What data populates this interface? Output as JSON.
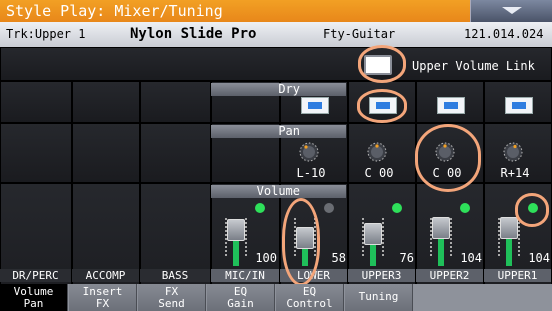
{
  "titlebar": {
    "title": "Style Play: Mixer/Tuning"
  },
  "trkbar": {
    "track": "Trk:Upper 1",
    "sound": "Nylon Slide Pro",
    "bank": "Fty-Guitar",
    "program": "121.014.024"
  },
  "upper_volume_link": {
    "label": "Upper Volume Link",
    "checked": false
  },
  "sections": {
    "dry": "Dry",
    "pan": "Pan",
    "volume": "Volume"
  },
  "channels": [
    {
      "name": "DR/PERC"
    },
    {
      "name": "ACCOMP"
    },
    {
      "name": "BASS"
    },
    {
      "name": "MIC/IN",
      "pan": "L-10",
      "volume": "100",
      "led": "on",
      "fader_level": 0.66
    },
    {
      "name": "LOWER",
      "volume": "58",
      "led": "off",
      "fader_level": 0.45
    },
    {
      "name": "UPPER3",
      "pan": "C 00",
      "volume": "76",
      "led": "on",
      "fader_level": 0.55
    },
    {
      "name": "UPPER2",
      "pan": "C 00",
      "volume": "104",
      "led": "on",
      "fader_level": 0.7
    },
    {
      "name": "UPPER1",
      "pan": "R+14",
      "volume": "104",
      "led": "on",
      "fader_level": 0.7
    }
  ],
  "tabs": [
    {
      "label": "Volume Pan",
      "active": true
    },
    {
      "label": "Insert FX"
    },
    {
      "label": "FX Send"
    },
    {
      "label": "EQ Gain"
    },
    {
      "label": "EQ Control"
    },
    {
      "label": "Tuning"
    }
  ],
  "colors": {
    "titlebar": "#e8871a",
    "led_on": "#2ee05a",
    "dry_indicator": "#2f7de0",
    "annotation": "#f3a57a"
  }
}
